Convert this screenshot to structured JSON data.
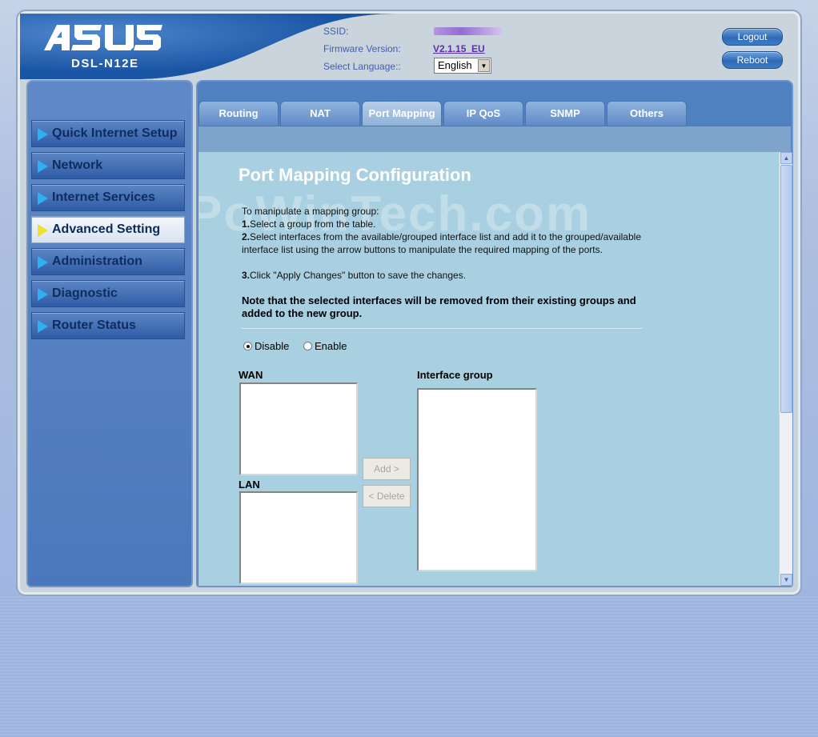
{
  "header": {
    "brand": "ASUS",
    "model": "DSL-N12E",
    "ssid_label": "SSID:",
    "firmware_label": "Firmware Version:",
    "firmware_value": "V2.1.15_EU",
    "language_label": "Select Language::",
    "language_value": "English",
    "logout_label": "Logout",
    "reboot_label": "Reboot"
  },
  "sidebar": {
    "items": [
      {
        "label": "Quick Internet Setup"
      },
      {
        "label": "Network"
      },
      {
        "label": "Internet Services"
      },
      {
        "label": "Advanced Setting"
      },
      {
        "label": "Administration"
      },
      {
        "label": "Diagnostic"
      },
      {
        "label": "Router Status"
      }
    ]
  },
  "tabs": [
    {
      "label": "Routing"
    },
    {
      "label": "NAT"
    },
    {
      "label": "Port Mapping"
    },
    {
      "label": "IP QoS"
    },
    {
      "label": "SNMP"
    },
    {
      "label": "Others"
    }
  ],
  "main": {
    "watermark": "PoWinTech.com",
    "title": "Port Mapping Configuration",
    "intro": "To manipulate a mapping group:",
    "step1_num": "1.",
    "step1": "Select a group from the table.",
    "step2_num": "2.",
    "step2": "Select interfaces from the available/grouped interface list and add it to the grouped/available interface list using the arrow buttons to manipulate the required mapping of the ports.",
    "step3_num": "3.",
    "step3": "Click \"Apply Changes\" button to save the changes.",
    "note": "Note that the selected interfaces will be removed from their existing groups and added to the new group.",
    "radio_disable": "Disable",
    "radio_enable": "Enable",
    "wan_label": "WAN",
    "lan_label": "LAN",
    "interface_group_label": "Interface group",
    "add_button": "Add >",
    "delete_button": "< Delete"
  },
  "colors": {
    "brand_blue": "#1a55a5",
    "panel_bg": "#a8d0e0",
    "active_indicator": "#f0e02a"
  }
}
